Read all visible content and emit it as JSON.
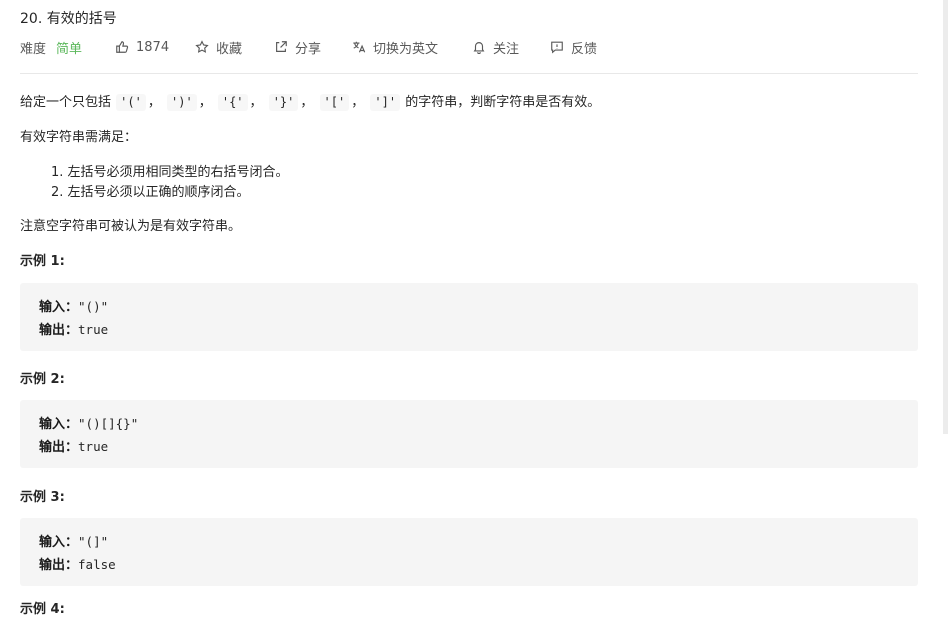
{
  "problem": {
    "title": "20. 有效的括号",
    "difficulty_label": "难度",
    "difficulty_value": "简单",
    "likes": "1874",
    "favorite": "收藏",
    "share": "分享",
    "switch_lang": "切换为英文",
    "follow": "关注",
    "feedback": "反馈"
  },
  "description": {
    "intro_prefix": "给定一个只包括",
    "chars": [
      "'('",
      "')'",
      "'{'",
      "'}'",
      "'['",
      "']'"
    ],
    "separator": "，",
    "intro_suffix": "的字符串，判断字符串是否有效。",
    "valid_requirements": "有效字符串需满足：",
    "rules": [
      "1. 左括号必须用相同类型的右括号闭合。",
      "2. 左括号必须以正确的顺序闭合。"
    ],
    "note": "注意空字符串可被认为是有效字符串。"
  },
  "examples": [
    {
      "heading": "示例 1:",
      "input_label": "输入：",
      "input": "\"()\"",
      "output_label": "输出：",
      "output": "true"
    },
    {
      "heading": "示例 2:",
      "input_label": "输入：",
      "input": "\"()[]{}\"",
      "output_label": "输出：",
      "output": "true"
    },
    {
      "heading": "示例 3:",
      "input_label": "输入：",
      "input": "\"(]\"",
      "output_label": "输出：",
      "output": "false"
    }
  ],
  "next_heading_partial": "示例 4:",
  "colors": {
    "accent_easy": "#5cb85c",
    "text": "#262626",
    "muted": "#595959",
    "code_bg": "#f5f5f5"
  }
}
